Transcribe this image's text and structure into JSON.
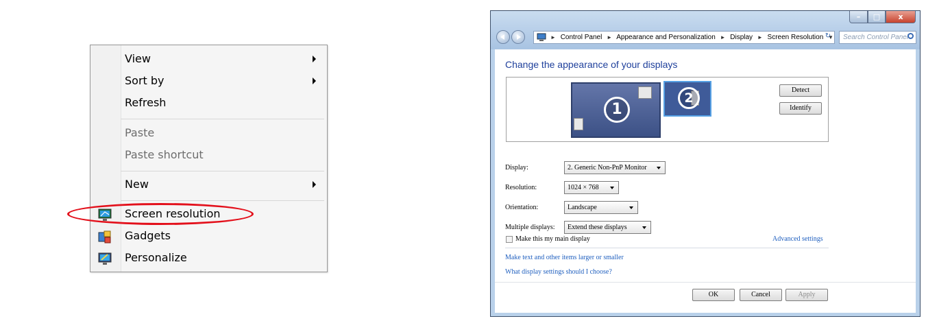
{
  "context_menu": {
    "items": [
      {
        "label": "View",
        "submenu": true,
        "disabled": false
      },
      {
        "label": "Sort by",
        "submenu": true,
        "disabled": false
      },
      {
        "label": "Refresh",
        "submenu": false,
        "disabled": false
      },
      {
        "label": "Paste",
        "submenu": false,
        "disabled": true
      },
      {
        "label": "Paste shortcut",
        "submenu": false,
        "disabled": true
      },
      {
        "label": "New",
        "submenu": true,
        "disabled": false
      },
      {
        "label": "Screen resolution",
        "submenu": false,
        "disabled": false,
        "icon": "monitor-icon",
        "highlighted": true
      },
      {
        "label": "Gadgets",
        "submenu": false,
        "disabled": false,
        "icon": "gadgets-icon"
      },
      {
        "label": "Personalize",
        "submenu": false,
        "disabled": false,
        "icon": "personalize-icon"
      }
    ],
    "highlight_color": "#e3101b"
  },
  "window": {
    "breadcrumbs": [
      "Control Panel",
      "Appearance and Personalization",
      "Display",
      "Screen Resolution"
    ],
    "search_placeholder": "Search Control Panel",
    "heading": "Change the appearance of your displays",
    "monitors": {
      "primary_number": "1",
      "secondary_number": "2"
    },
    "detect_label": "Detect",
    "identify_label": "Identify",
    "display_label": "Display:",
    "display_value": "2. Generic Non-PnP Monitor",
    "resolution_label": "Resolution:",
    "resolution_value": "1024 × 768",
    "orientation_label": "Orientation:",
    "orientation_value": "Landscape",
    "multiple_label": "Multiple displays:",
    "multiple_value": "Extend these displays",
    "main_display_label": "Make this my main display",
    "advanced_link": "Advanced settings",
    "link1": "Make text and other items larger or smaller",
    "link2": "What display settings should I choose?",
    "ok_label": "OK",
    "cancel_label": "Cancel",
    "apply_label": "Apply"
  }
}
